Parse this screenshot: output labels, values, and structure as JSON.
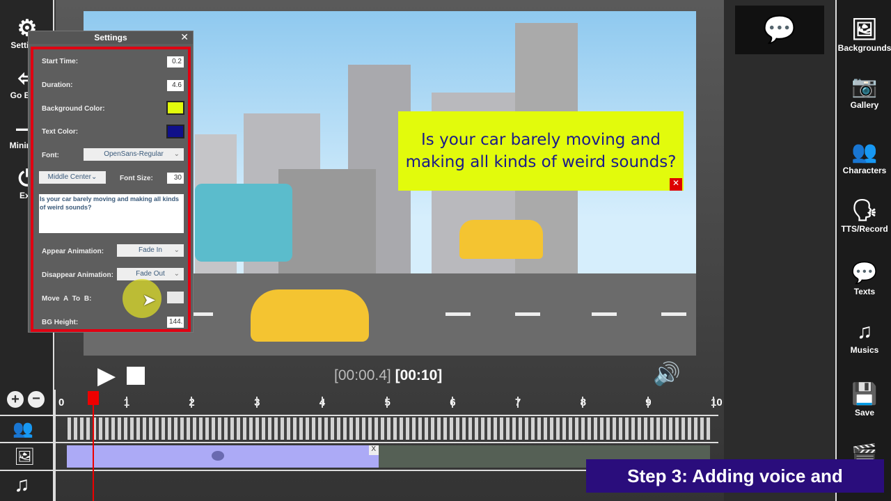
{
  "left_sidebar": {
    "items": [
      {
        "label": "Settings",
        "icon": "gear-icon"
      },
      {
        "label": "Go Back",
        "icon": "back-icon"
      },
      {
        "label": "Minimize",
        "icon": "minimize-icon"
      },
      {
        "label": "Exit",
        "icon": "power-icon"
      }
    ]
  },
  "settings": {
    "title": "Settings",
    "close": "✕",
    "start_time_label": "Start Time:",
    "start_time": "0.2",
    "duration_label": "Duration:",
    "duration": "4.6",
    "bg_color_label": "Background Color:",
    "bg_color": "#e2fb0c",
    "text_color_label": "Text Color:",
    "text_color": "#10108a",
    "font_label": "Font:",
    "font": "OpenSans-Regular",
    "alignment": "Middle Center",
    "font_size_label": "Font Size:",
    "font_size": "30",
    "text": "Is your car barely moving and making all kinds of weird sounds?",
    "appear_label": "Appear Animation:",
    "appear": "Fade In",
    "disappear_label": "Disappear Animation:",
    "disappear": "Fade Out",
    "move_label": "Move  A  To  B:",
    "bg_height_label": "BG Height:",
    "bg_height": "144."
  },
  "canvas": {
    "caption": "Is your car barely moving and making all kinds of weird sounds?"
  },
  "playback": {
    "current": "[00:00.4]",
    "total": "[00:10]"
  },
  "timeline": {
    "ticks": [
      "0",
      "1",
      "2",
      "3",
      "4",
      "5",
      "6",
      "7",
      "8",
      "9",
      "10"
    ],
    "playhead_seconds": 0.4,
    "text_clip_end_seconds": 4.8,
    "clip_close": "X"
  },
  "right_sidebar": {
    "items": [
      {
        "label": "Backgrounds",
        "icon": "image-icon"
      },
      {
        "label": "Gallery",
        "icon": "camera-icon"
      },
      {
        "label": "Characters",
        "icon": "people-icon"
      },
      {
        "label": "TTS/Record",
        "icon": "voice-icon"
      },
      {
        "label": "Texts",
        "icon": "speech-bubble-icon"
      },
      {
        "label": "Musics",
        "icon": "music-icon"
      },
      {
        "label": "Save",
        "icon": "save-icon"
      }
    ]
  },
  "banner": "Step 3: Adding voice and"
}
